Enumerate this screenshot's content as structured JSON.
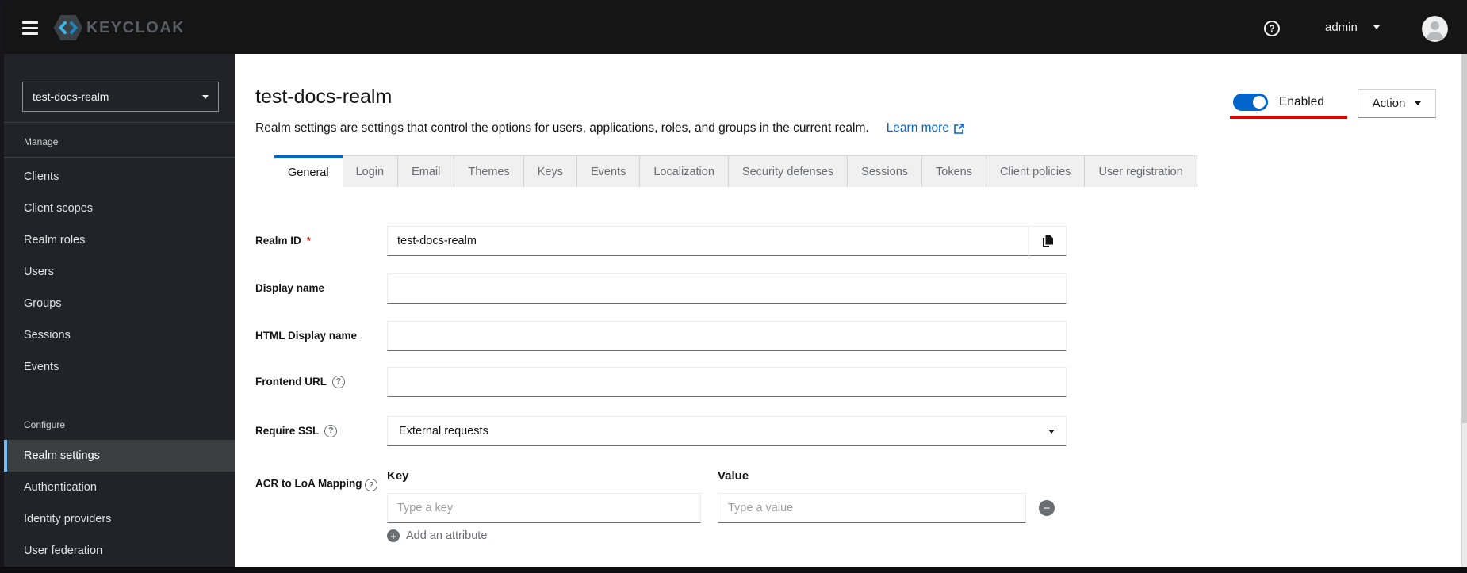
{
  "masthead": {
    "brand": "KEYCLOAK",
    "username": "admin"
  },
  "sidebar": {
    "realm_selector": "test-docs-realm",
    "groups": [
      {
        "title": "Manage",
        "items": [
          "Clients",
          "Client scopes",
          "Realm roles",
          "Users",
          "Groups",
          "Sessions",
          "Events"
        ]
      },
      {
        "title": "Configure",
        "items": [
          "Realm settings",
          "Authentication",
          "Identity providers",
          "User federation"
        ],
        "active_item": "Realm settings"
      }
    ]
  },
  "header": {
    "title": "test-docs-realm",
    "description": "Realm settings are settings that control the options for users, applications, roles, and groups in the current realm.",
    "learn_more": "Learn more",
    "enabled_label": "Enabled",
    "enabled_state": "on",
    "action_label": "Action"
  },
  "tabs": {
    "active": "General",
    "items": [
      "General",
      "Login",
      "Email",
      "Themes",
      "Keys",
      "Events",
      "Localization",
      "Security defenses",
      "Sessions",
      "Tokens",
      "Client policies",
      "User registration"
    ]
  },
  "form": {
    "realm_id": {
      "label": "Realm ID",
      "required_marker": "*",
      "value": "test-docs-realm"
    },
    "display_name": {
      "label": "Display name",
      "value": ""
    },
    "html_display_name": {
      "label": "HTML Display name",
      "value": ""
    },
    "frontend_url": {
      "label": "Frontend URL",
      "value": ""
    },
    "require_ssl": {
      "label": "Require SSL",
      "value": "External requests"
    },
    "acr_loa": {
      "label": "ACR to LoA Mapping",
      "key_header": "Key",
      "value_header": "Value",
      "key_placeholder": "Type a key",
      "value_placeholder": "Type a value",
      "add_label": "Add an attribute"
    }
  },
  "icons": {
    "help": "?",
    "minus": "−",
    "plus": "+"
  },
  "colors": {
    "accent_blue": "#0066cc",
    "annotation_red": "#e60000",
    "nav_active_indicator": "#73bcf7",
    "masthead_bg": "#151515",
    "sidebar_bg": "#212328"
  }
}
